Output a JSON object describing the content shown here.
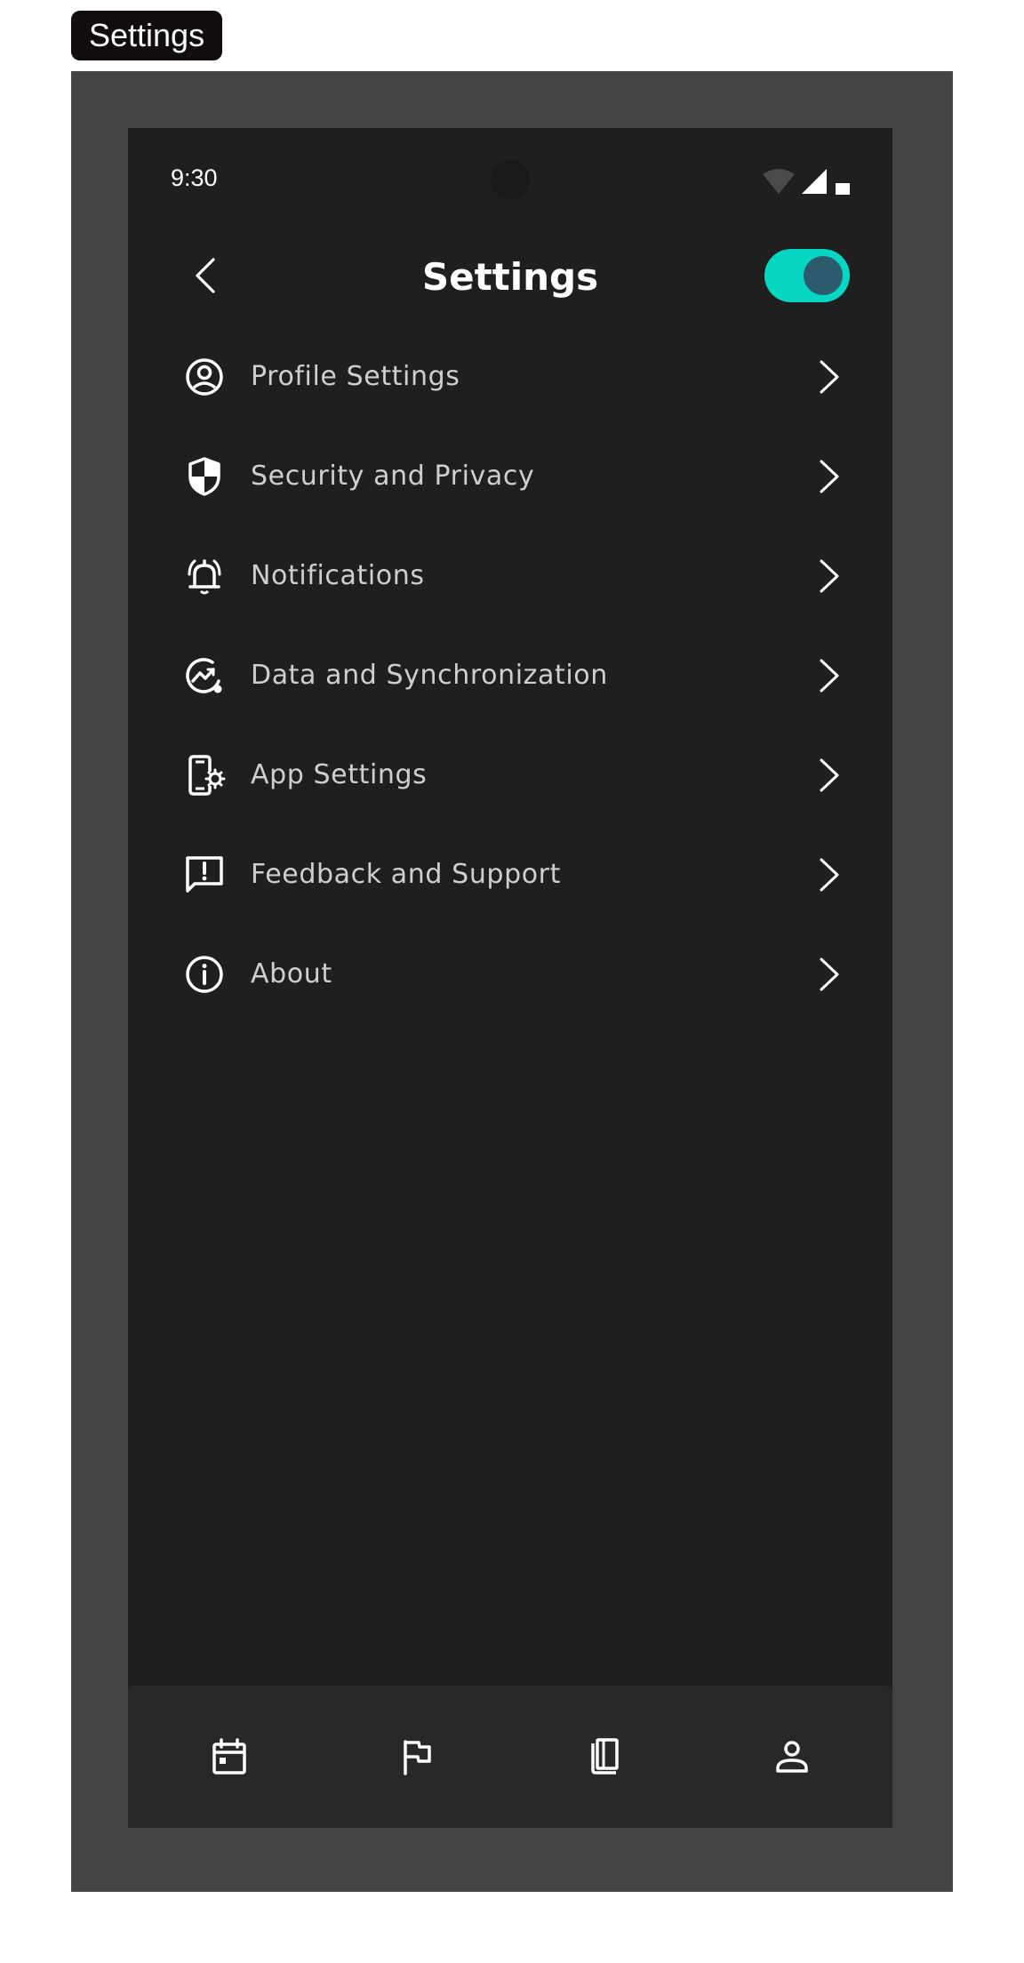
{
  "frame": {
    "label": "Settings"
  },
  "status_bar": {
    "time": "9:30",
    "icons": [
      "wifi-icon",
      "signal-icon",
      "battery-icon"
    ]
  },
  "header": {
    "title": "Settings",
    "back_icon": "chevron-left-icon",
    "toggle_on": true
  },
  "menu": {
    "items": [
      {
        "label": "Profile Settings",
        "icon": "account-circle-icon"
      },
      {
        "label": "Security and Privacy",
        "icon": "shield-icon"
      },
      {
        "label": "Notifications",
        "icon": "bell-ringing-icon"
      },
      {
        "label": "Data and Synchronization",
        "icon": "chart-sync-icon"
      },
      {
        "label": "App Settings",
        "icon": "phone-gear-icon"
      },
      {
        "label": "Feedback and Support",
        "icon": "feedback-icon"
      },
      {
        "label": "About",
        "icon": "info-icon"
      }
    ]
  },
  "bottom_nav": {
    "items": [
      "calendar-icon",
      "flag-icon",
      "book-icon",
      "person-icon"
    ]
  },
  "colors": {
    "background": "#1f1f1f",
    "accent": "#07d7c2",
    "toggle_knob": "#2b5b6d",
    "nav_background": "#282828",
    "frame": "#444444"
  }
}
